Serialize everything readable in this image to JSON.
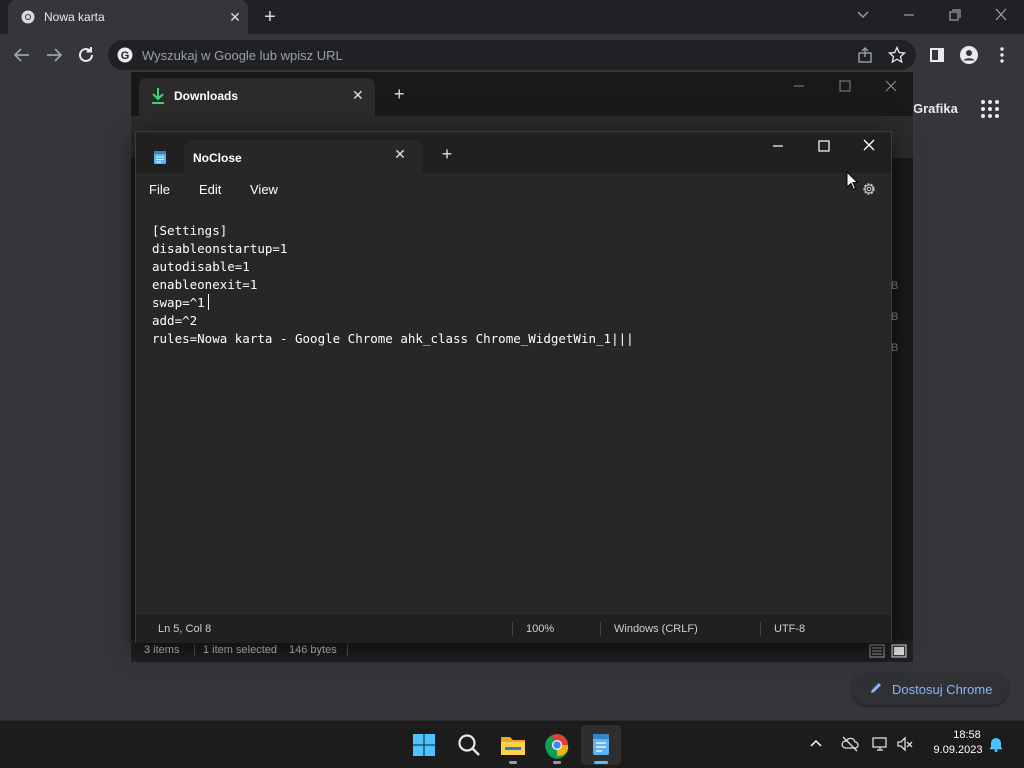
{
  "chrome": {
    "tab_title": "Nowa karta",
    "tab_close": "✕",
    "new_tab": "+",
    "omnibox_placeholder": "Wyszukaj w Google lub wpisz URL",
    "grafika_link": "Grafika",
    "customize_label": "Dostosuj Chrome",
    "accent_color": "#8ab4f8"
  },
  "explorer": {
    "tab_title": "Downloads",
    "tab_close": "✕",
    "new_tab": "+",
    "status_items": "3 items",
    "status_selected": "1 item selected",
    "status_size": "146 bytes",
    "side_b1": "B",
    "side_b2": "B",
    "side_b3": "B"
  },
  "notepad": {
    "tab_title": "NoClose",
    "tab_close": "✕",
    "new_tab": "+",
    "menu": {
      "file": "File",
      "edit": "Edit",
      "view": "View"
    },
    "content": "[Settings]\ndisableonstartup=1\nautodisable=1\nenableonexit=1\nswap=^1\nadd=^2\nrules=Nowa karta - Google Chrome ahk_class Chrome_WidgetWin_1|||",
    "status": {
      "position": "Ln 5, Col 8",
      "zoom": "100%",
      "line_ending": "Windows (CRLF)",
      "encoding": "UTF-8"
    }
  },
  "taskbar": {
    "time": "18:58",
    "date": "9.09.2023",
    "apps": [
      "start-icon",
      "search-icon",
      "file-explorer-icon",
      "chrome-icon",
      "notepad-icon"
    ],
    "tray": [
      "chevron-up-icon",
      "onedrive-off-icon",
      "display-icon",
      "volume-muted-icon",
      "notification-bell-icon"
    ]
  }
}
